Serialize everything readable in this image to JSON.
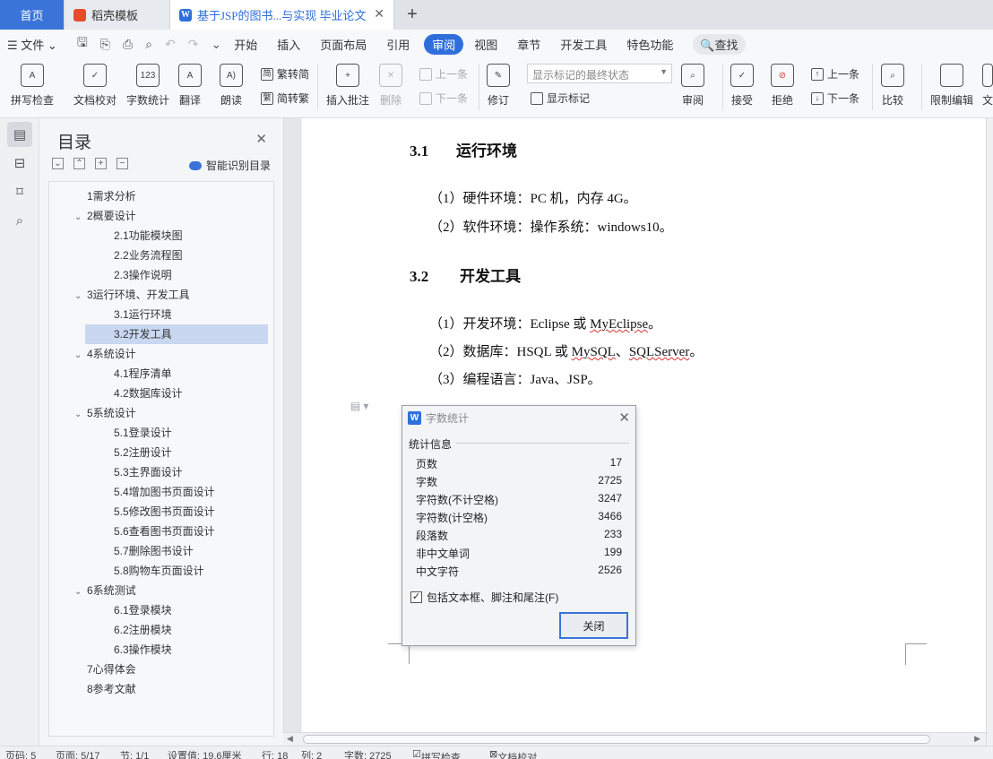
{
  "tabs": {
    "home": "首页",
    "template": "稻壳模板",
    "document": "基于JSP的图书...与实现 毕业论文",
    "doc_icon": "W"
  },
  "menu": {
    "file": "文件",
    "items": [
      "开始",
      "插入",
      "页面布局",
      "引用",
      "审阅",
      "视图",
      "章节",
      "开发工具",
      "特色功能"
    ],
    "active": "审阅",
    "search": "查找"
  },
  "ribbon": {
    "spell_check": "拼写检查",
    "doc_proof": "文档校对",
    "word_count": "字数统计",
    "translate": "翻译",
    "read_aloud": "朗读",
    "trad_to_simp": "繁转简",
    "simp_to_trad": "简转繁",
    "insert_comment": "插入批注",
    "delete": "删除",
    "prev_comment": "上一条",
    "next_comment": "下一条",
    "track_changes": "修订",
    "markup_mode": "显示标记的最终状态",
    "show_markup": "显示标记",
    "review": "审阅",
    "accept": "接受",
    "reject": "拒绝",
    "prev_change": "上一条",
    "next_change": "下一条",
    "compare": "比较",
    "restrict_edit": "限制编辑",
    "more": "文",
    "word_count_icon_text": "123"
  },
  "toc": {
    "title": "目录",
    "smart": "智能识别目录",
    "selected": "3.2开发工具",
    "items": [
      {
        "label": "1需求分析",
        "level": 1,
        "toggle": ""
      },
      {
        "label": "2概要设计",
        "level": 1,
        "toggle": "⌄"
      },
      {
        "label": "2.1功能模块图",
        "level": 2,
        "toggle": ""
      },
      {
        "label": "2.2业务流程图",
        "level": 2,
        "toggle": ""
      },
      {
        "label": "2.3操作说明",
        "level": 2,
        "toggle": ""
      },
      {
        "label": "3运行环境、开发工具",
        "level": 1,
        "toggle": "⌄"
      },
      {
        "label": "3.1运行环境",
        "level": 2,
        "toggle": ""
      },
      {
        "label": "3.2开发工具",
        "level": 2,
        "toggle": ""
      },
      {
        "label": "4系统设计",
        "level": 1,
        "toggle": "⌄"
      },
      {
        "label": "4.1程序清单",
        "level": 2,
        "toggle": ""
      },
      {
        "label": "4.2数据库设计",
        "level": 2,
        "toggle": ""
      },
      {
        "label": "5系统设计",
        "level": 1,
        "toggle": "⌄"
      },
      {
        "label": "5.1登录设计",
        "level": 2,
        "toggle": ""
      },
      {
        "label": "5.2注册设计",
        "level": 2,
        "toggle": ""
      },
      {
        "label": "5.3主界面设计",
        "level": 2,
        "toggle": ""
      },
      {
        "label": "5.4增加图书页面设计",
        "level": 2,
        "toggle": ""
      },
      {
        "label": "5.5修改图书页面设计",
        "level": 2,
        "toggle": ""
      },
      {
        "label": "5.6查看图书页面设计",
        "level": 2,
        "toggle": ""
      },
      {
        "label": "5.7删除图书设计",
        "level": 2,
        "toggle": ""
      },
      {
        "label": "5.8购物车页面设计",
        "level": 2,
        "toggle": ""
      },
      {
        "label": "6系统测试",
        "level": 1,
        "toggle": "⌄"
      },
      {
        "label": "6.1登录模块",
        "level": 2,
        "toggle": ""
      },
      {
        "label": "6.2注册模块",
        "level": 2,
        "toggle": ""
      },
      {
        "label": "6.3操作模块",
        "level": 2,
        "toggle": ""
      },
      {
        "label": "7心得体会",
        "level": 1,
        "toggle": ""
      },
      {
        "label": "8参考文献",
        "level": 1,
        "toggle": ""
      }
    ]
  },
  "document": {
    "h1_num": "3.1",
    "h1_text": "运行环境",
    "p1": "（1）硬件环境：PC 机，内存 4G。",
    "p2": "（2）软件环境：操作系统：windows10。",
    "h2_num": "3.2",
    "h2_text": "开发工具",
    "p3_a": "（1）开发环境：Eclipse 或 ",
    "p3_b": "MyEclipse",
    "p3_c": "。",
    "p4_a": "（2）数据库：HSQL 或 ",
    "p4_b": "MySQL",
    "p4_c": "、",
    "p4_d": "SQLServer",
    "p4_e": "。",
    "p5": "（3）编程语言：Java、JSP。"
  },
  "dialog": {
    "title": "字数统计",
    "group": "统计信息",
    "stats": [
      {
        "label": "页数",
        "value": "17"
      },
      {
        "label": "字数",
        "value": "2725"
      },
      {
        "label": "字符数(不计空格)",
        "value": "3247"
      },
      {
        "label": "字符数(计空格)",
        "value": "3466"
      },
      {
        "label": "段落数",
        "value": "233"
      },
      {
        "label": "非中文单词",
        "value": "199"
      },
      {
        "label": "中文字符",
        "value": "2526"
      }
    ],
    "checkbox": "包括文本框、脚注和尾注(F)",
    "checked": true,
    "close": "关闭"
  },
  "status": {
    "page_num": "页码: 5",
    "pages": "页面: 5/17",
    "section": "节: 1/1",
    "setting": "设置值: 19.6厘米",
    "row": "行: 18",
    "col": "列: 2",
    "words": "字数: 2725",
    "spell": "拼写检查",
    "proof": "文档校对"
  },
  "colors": {
    "accent": "#2f6fdc",
    "selected_toc": "#c9d7f0",
    "spell_error": "#d33333"
  }
}
